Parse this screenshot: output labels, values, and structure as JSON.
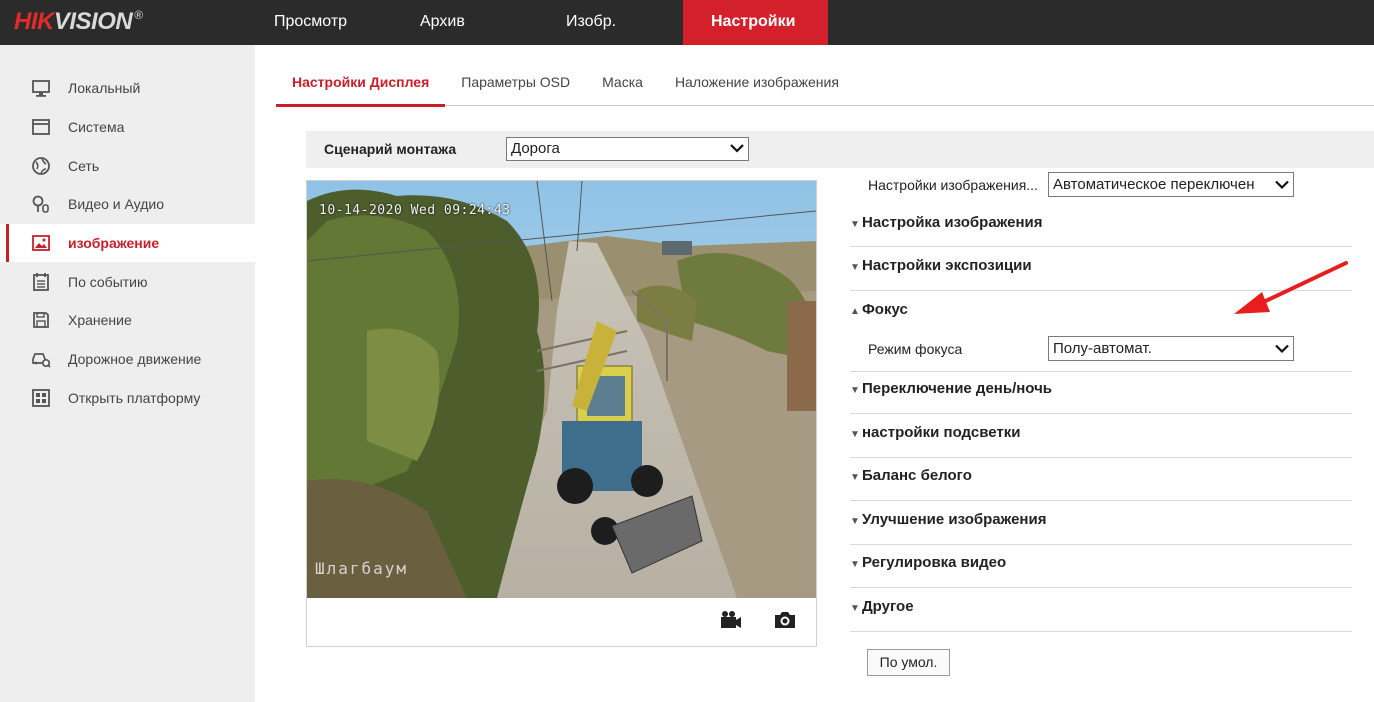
{
  "logo": {
    "brand_red": "HIK",
    "brand_grey": "VISION",
    "reg": "®"
  },
  "topnav": [
    {
      "label": "Просмотр",
      "active": false
    },
    {
      "label": "Архив",
      "active": false
    },
    {
      "label": "Изобр.",
      "active": false
    },
    {
      "label": "Настройки",
      "active": true
    }
  ],
  "sidebar": {
    "items": [
      {
        "label": "Локальный",
        "icon": "monitor-icon"
      },
      {
        "label": "Система",
        "icon": "system-icon"
      },
      {
        "label": "Сеть",
        "icon": "globe-icon"
      },
      {
        "label": "Видео и Аудио",
        "icon": "camera-mic-icon"
      },
      {
        "label": "изображение",
        "icon": "image-icon",
        "active": true
      },
      {
        "label": "По событию",
        "icon": "calendar-icon"
      },
      {
        "label": "Хранение",
        "icon": "save-icon"
      },
      {
        "label": "Дорожное движение",
        "icon": "car-search-icon"
      },
      {
        "label": "Открыть платформу",
        "icon": "grid-icon"
      }
    ]
  },
  "subtabs": [
    {
      "label": "Настройки Дисплея",
      "active": true
    },
    {
      "label": "Параметры OSD"
    },
    {
      "label": "Маска"
    },
    {
      "label": "Наложение изображения"
    }
  ],
  "scenario": {
    "label": "Сценарий монтажа",
    "value": "Дорога"
  },
  "video": {
    "osd_time": "10-14-2020 Wed 09:24:43",
    "osd_name": "Шлагбаум"
  },
  "image_settings": {
    "label": "Настройки изображения...",
    "value": "Автоматическое переключен"
  },
  "sections": {
    "image_adjust": "Настройка изображения",
    "exposure": "Настройки экспозиции",
    "focus": "Фокус",
    "focus_mode_label": "Режим фокуса",
    "focus_mode_value": "Полу-автомат.",
    "day_night": "Переключение день/ночь",
    "backlight": "настройки подсветки",
    "white_balance": "Баланс белого",
    "enhancement": "Улучшение изображения",
    "video_adjust": "Регулировка видео",
    "other": "Другое"
  },
  "default_button": "По умол.",
  "colors": {
    "accent": "#d4202b",
    "topbar": "#2b2b2b",
    "sidebar": "#eeeeee"
  }
}
